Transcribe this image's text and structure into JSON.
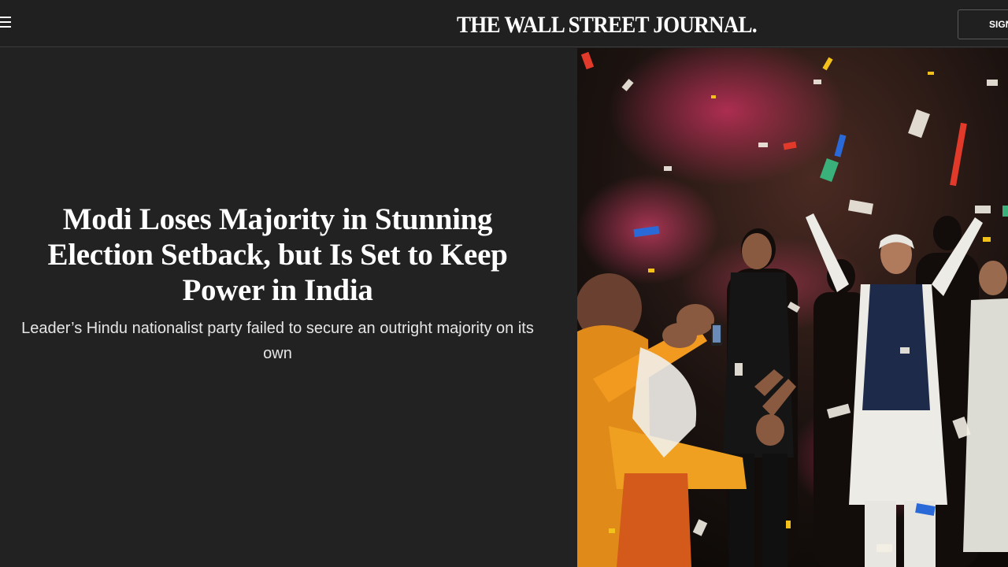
{
  "header": {
    "logo_text": "THE WALL STREET JOURNAL.",
    "signin_label": "SIGN IN",
    "menu_icon": "hamburger-menu-icon"
  },
  "article": {
    "headline": "Modi Loses Majority in Stunning Election Setback, but Is Set to Keep Power in India",
    "dek": "Leader’s Hindu nationalist party failed to secure an outright majority on its own"
  },
  "hero_image": {
    "subject": "photo of crowd celebrating under falling confetti and flower petals"
  },
  "colors": {
    "page_background": "#222222",
    "header_background": "#202020",
    "text": "#ffffff",
    "dek_text": "#e6e6e6",
    "petal_pink": "#c2305a",
    "saffron": "#f29a1f"
  }
}
